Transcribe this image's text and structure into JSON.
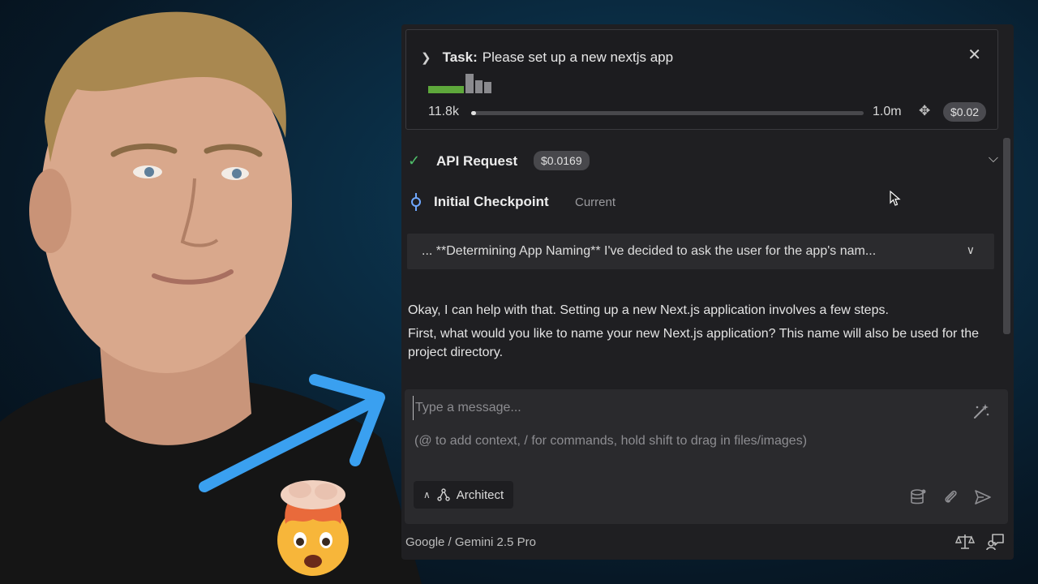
{
  "task": {
    "label": "Task:",
    "text": "Please set up a new nextjs app",
    "close_icon": "close-icon",
    "context_used": "11.8k",
    "context_max": "1.0m",
    "context_progress": 0.012,
    "total_cost": "$0.02"
  },
  "api_request": {
    "title": "API Request",
    "cost": "$0.0169"
  },
  "checkpoint": {
    "title": "Initial Checkpoint",
    "badge": "Current"
  },
  "reasoning": {
    "text": "... **Determining App Naming** I've decided to ask the user for the app's nam..."
  },
  "messages": [
    "Okay, I can help with that. Setting up a new Next.js application involves a few steps.",
    "First, what would you like to name your new Next.js application? This name will also be used for the project directory."
  ],
  "input": {
    "placeholder": "Type a message...",
    "hint": "(@ to add context, / for commands, hold shift to drag in files/images)"
  },
  "mode": {
    "label": "Architect"
  },
  "footer": {
    "model": "Google / Gemini 2.5 Pro"
  },
  "colors": {
    "accent_green": "#4fbf6a",
    "checkpoint_blue": "#6fa8ff",
    "arrow_blue": "#3aa0f0"
  }
}
